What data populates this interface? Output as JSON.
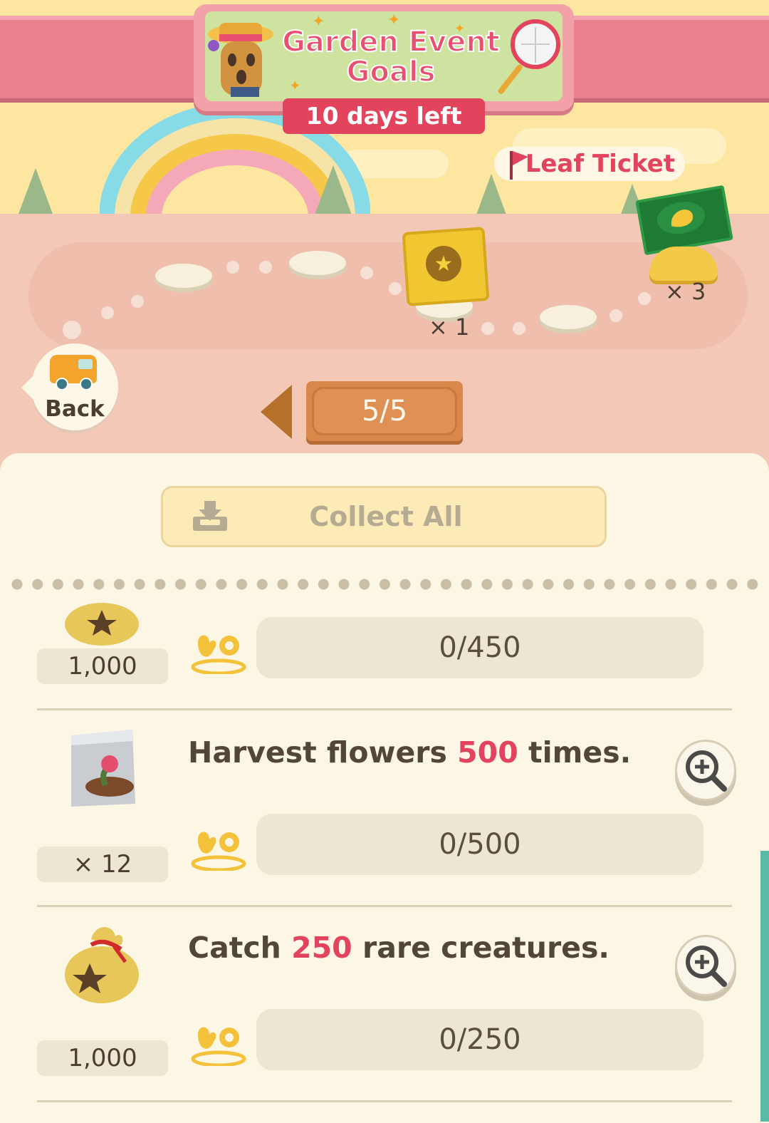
{
  "header": {
    "title_line1": "Garden Event",
    "title_line2": "Goals",
    "days_left": "10 days left"
  },
  "rewards_track": {
    "leaf_ticket_label": "Leaf Ticket",
    "leaf_ticket_count": "× 3",
    "map_reward_count": "× 1"
  },
  "nav": {
    "back_label": "Back",
    "page_indicator": "5/5"
  },
  "panel": {
    "collect_all_label": "Collect All"
  },
  "goals": [
    {
      "reward_qty": "1,000",
      "task_prefix": "",
      "task_highlight": "",
      "task_suffix": "",
      "progress": "0/450",
      "reward_icon": "bell-bag-icon"
    },
    {
      "reward_qty": "× 12",
      "task_prefix": "Harvest flowers ",
      "task_highlight": "500",
      "task_suffix": " times.",
      "progress": "0/500",
      "reward_icon": "seed-bag-icon"
    },
    {
      "reward_qty": "1,000",
      "task_prefix": "Catch ",
      "task_highlight": "250",
      "task_suffix": " rare creatures.",
      "progress": "0/250",
      "reward_icon": "bell-bag-icon"
    }
  ],
  "colors": {
    "accent_red": "#e2435d",
    "panel_bg": "#fcf6e5",
    "scroll_thumb": "#5bb9a8"
  }
}
